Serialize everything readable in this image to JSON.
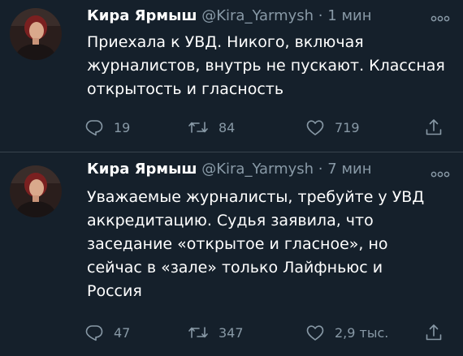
{
  "tweets": [
    {
      "author_name": "Кира Ярмыш",
      "handle": "@Kira_Yarmysh",
      "separator": "·",
      "time": "1 мин",
      "text": "Приехала к УВД. Никого, включая\nжурналистов, внутрь не пускают. Классная\nоткрытость и гласность",
      "replies": "19",
      "retweets": "84",
      "likes": "719",
      "icons": [
        "reply-icon",
        "retweet-icon",
        "like-icon",
        "share-icon",
        "more-icon"
      ]
    },
    {
      "author_name": "Кира Ярмыш",
      "handle": "@Kira_Yarmysh",
      "separator": "·",
      "time": "7 мин",
      "text": "Уважаемые журналисты, требуйте у УВД\nаккредитацию. Судья заявила, что\nзаседание «открытое и гласное», но\nсейчас в «зале» только Лайфньюс и\nРоссия",
      "replies": "47",
      "retweets": "347",
      "likes": "2,9 тыс.",
      "icons": [
        "reply-icon",
        "retweet-icon",
        "like-icon",
        "share-icon",
        "more-icon"
      ]
    }
  ],
  "colors": {
    "background": "#15202b",
    "divider": "#38444d",
    "text_primary": "#ffffff",
    "text_secondary": "#8899a6"
  }
}
